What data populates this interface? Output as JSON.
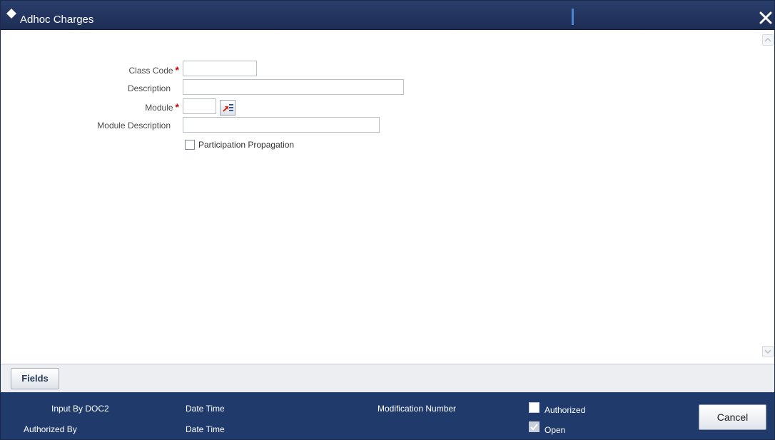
{
  "window": {
    "title": "Adhoc Charges",
    "close_icon": "close-icon",
    "title_icon": "diamond-icon"
  },
  "form": {
    "class_code": {
      "label": "Class Code",
      "required": "*",
      "value": ""
    },
    "description": {
      "label": "Description",
      "value": ""
    },
    "module": {
      "label": "Module",
      "required": "*",
      "value": "",
      "lov_icon": "list-of-values-icon"
    },
    "module_description": {
      "label": "Module Description",
      "value": ""
    },
    "participation_propagation": {
      "label": "Participation Propagation",
      "checked": false
    }
  },
  "tabs": [
    {
      "label": "Fields"
    }
  ],
  "footer": {
    "input_by": "Input By DOC2",
    "authorized_by": "Authorized By",
    "date_time_1": "Date Time",
    "date_time_2": "Date Time",
    "modification_number": "Modification Number",
    "authorized": {
      "label": "Authorized",
      "checked": false
    },
    "open": {
      "label": "Open",
      "checked": true
    },
    "cancel_label": "Cancel"
  },
  "colors": {
    "titlebar": "#1d2d54",
    "footer": "#1f3a6b",
    "required": "#cc0000"
  }
}
